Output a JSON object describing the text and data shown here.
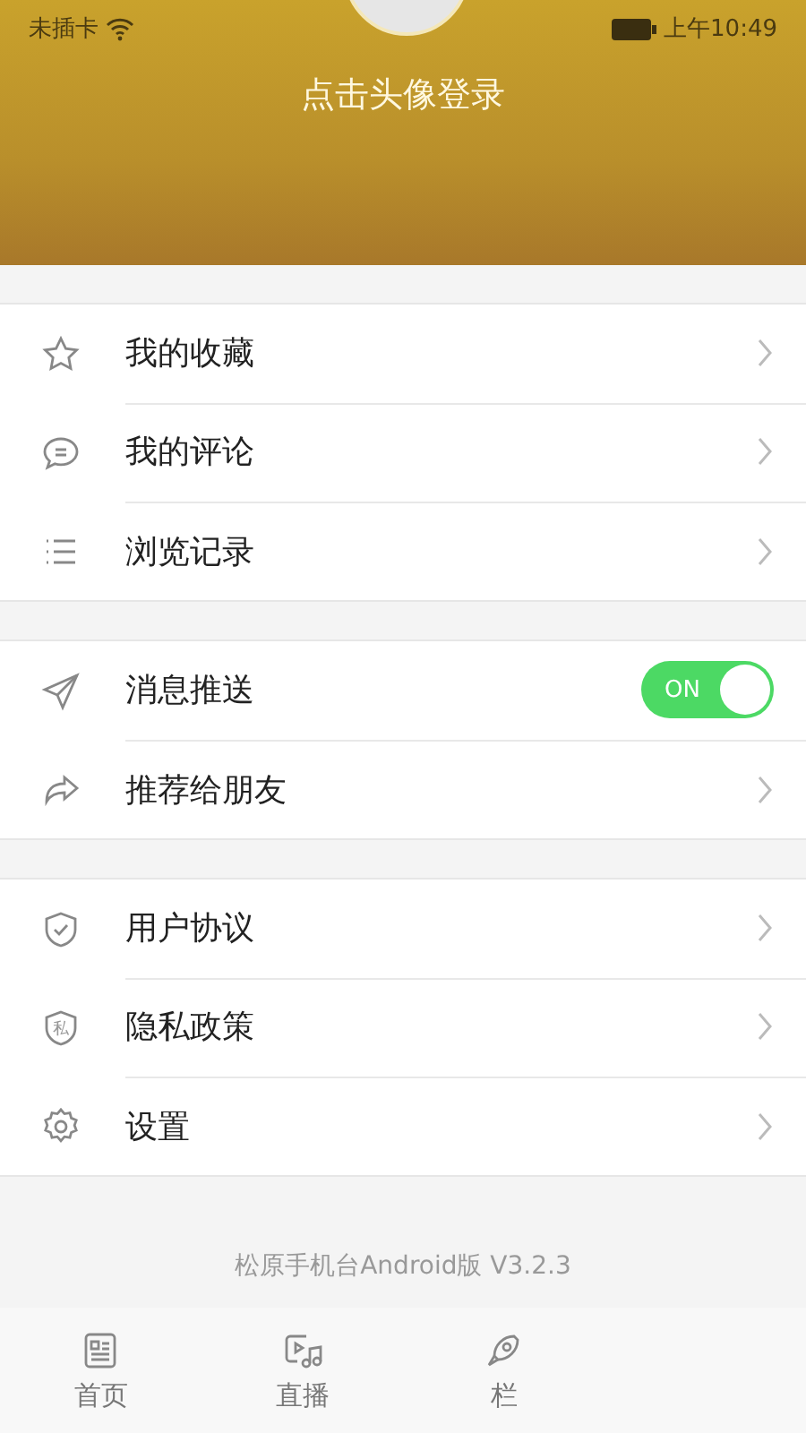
{
  "status_bar": {
    "carrier": "未插卡",
    "time": "上午10:49"
  },
  "header": {
    "login_prompt": "点击头像登录"
  },
  "sections": [
    {
      "items": [
        {
          "kind": "link",
          "label": "我的收藏"
        },
        {
          "kind": "link",
          "label": "我的评论"
        },
        {
          "kind": "link",
          "label": "浏览记录"
        }
      ]
    },
    {
      "items": [
        {
          "kind": "toggle",
          "label": "消息推送",
          "on": true,
          "toggle_text": "ON"
        },
        {
          "kind": "link",
          "label": "推荐给朋友"
        }
      ]
    },
    {
      "items": [
        {
          "kind": "link",
          "label": "用户协议"
        },
        {
          "kind": "link",
          "label": "隐私政策",
          "icon_text": "私"
        },
        {
          "kind": "link",
          "label": "设置"
        }
      ]
    }
  ],
  "version": "松原手机台Android版 V3.2.3",
  "tab_bar": [
    {
      "label": "首页"
    },
    {
      "label": "直播"
    },
    {
      "label": "栏"
    }
  ]
}
